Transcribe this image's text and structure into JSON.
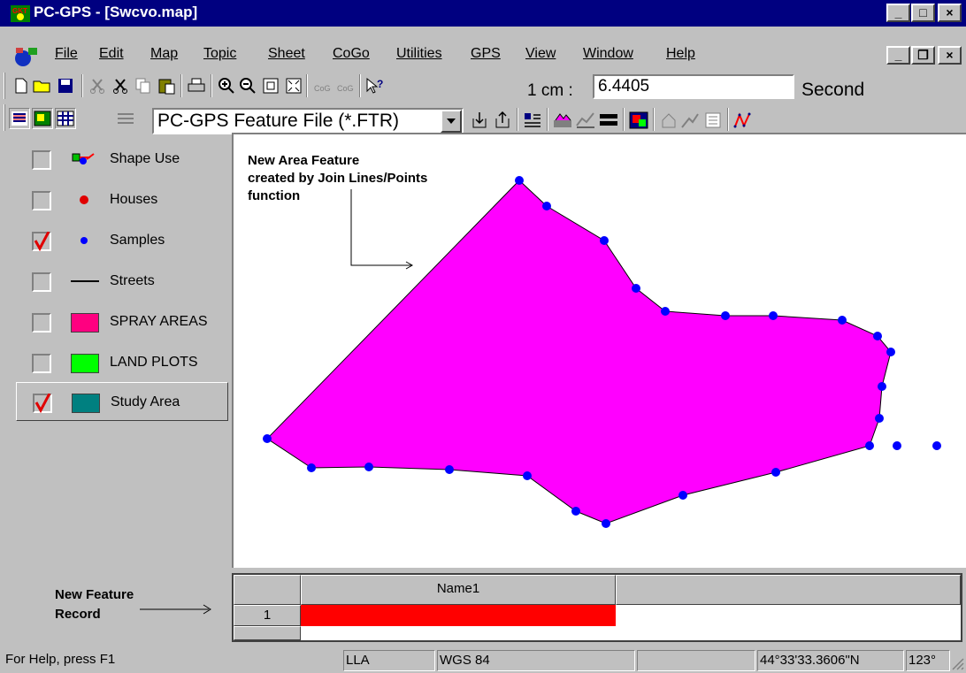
{
  "window": {
    "title": "PC-GPS - [Swcvo.map]",
    "minimize": "_",
    "maximize": "□",
    "close": "×",
    "doc_minimize": "_",
    "doc_restore": "❐",
    "doc_close": "×"
  },
  "menu": [
    "File",
    "Edit",
    "Map",
    "Topic",
    "Sheet",
    "CoGo",
    "Utilities",
    "GPS",
    "View",
    "Window",
    "Help"
  ],
  "toolbar1": {
    "scale_label": "1 cm :",
    "scale_value": "6.4405",
    "units": "Second"
  },
  "toolbar2": {
    "file_type": "PC-GPS Feature File (*.FTR)"
  },
  "layers": [
    {
      "label": "Shape Use",
      "checked": false,
      "icon": "shape-use-icon"
    },
    {
      "label": "Houses",
      "checked": false,
      "icon": "red-dot-icon",
      "color": "#e00000"
    },
    {
      "label": "Samples",
      "checked": true,
      "icon": "blue-dot-icon",
      "color": "#0000ff"
    },
    {
      "label": "Streets",
      "checked": false,
      "icon": "line-icon",
      "color": "#000000"
    },
    {
      "label": "SPRAY AREAS",
      "checked": false,
      "icon": "swatch",
      "color": "#ff0080"
    },
    {
      "label": "LAND PLOTS",
      "checked": false,
      "icon": "swatch",
      "color": "#00ff00"
    },
    {
      "label": "Study Area",
      "checked": true,
      "icon": "swatch",
      "color": "#008080"
    }
  ],
  "map": {
    "annotation_lines": [
      "New Area Feature",
      "created by Join Lines/Points",
      "function"
    ],
    "polygon_fill": "#ff00ff",
    "point_color": "#0000ff"
  },
  "record_note": [
    "New Feature",
    "Record"
  ],
  "grid": {
    "column_header": "Name1",
    "row_number": "1",
    "record_color": "#ff0000"
  },
  "status": {
    "help": "For Help, press F1",
    "coord_system": "LLA",
    "datum": "WGS 84",
    "empty": "",
    "latitude": "44°33'33.3606\"N",
    "longitude": "123°"
  }
}
